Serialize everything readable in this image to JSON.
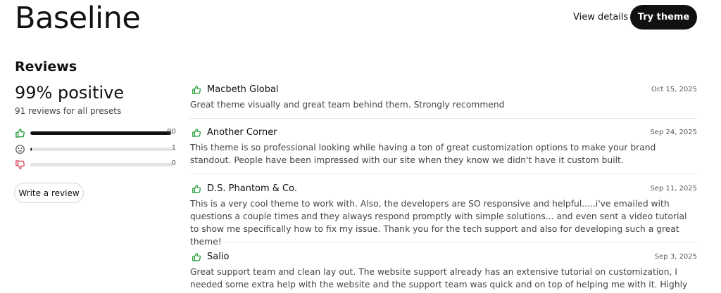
{
  "header": {
    "title": "Baseline",
    "view_details": "View details",
    "try_theme": "Try theme"
  },
  "summary": {
    "heading": "Reviews",
    "percent": "99% positive",
    "count": "91 reviews for all presets",
    "ratings": [
      {
        "name": "positive",
        "icon": "thumbs-up-icon",
        "count": "90",
        "fraction": 0.989
      },
      {
        "name": "neutral",
        "icon": "neutral-face-icon",
        "count": "1",
        "fraction": 0.011
      },
      {
        "name": "negative",
        "icon": "thumbs-down-icon",
        "count": "0",
        "fraction": 0.0
      }
    ],
    "write_review": "Write a review"
  },
  "reviews": [
    {
      "reviewer": "Macbeth Global",
      "date": "Oct 15, 2025",
      "text": "Great theme visually and great team behind them. Strongly recommend"
    },
    {
      "reviewer": "Another Corner",
      "date": "Sep 24, 2025",
      "text": "This theme is so professional looking while having a ton of great customization options to make your brand standout. People have been impressed with our site when they know we didn't have it custom built."
    },
    {
      "reviewer": "D.S. Phantom & Co.",
      "date": "Sep 11, 2025",
      "text": "This is a very cool theme to work with. Also, the developers are SO responsive and helpful.....i've emailed with questions a couple times and they always respond promptly with simple solutions... and even sent a video tutorial to show me specifically how to fix my issue. Thank you for the tech support and also for developing such a great theme!"
    },
    {
      "reviewer": "Salio",
      "date": "Sep 3, 2025",
      "text": "Great support team and clean lay out. The website support already has an extensive tutorial on customization, I needed some extra help with the website and the support team was quick and on top of helping me with it. Highly recommended!"
    }
  ],
  "colors": {
    "accent": "#111111",
    "positive_green": "#2e9e3f",
    "negative_red": "#e05561",
    "track_gray": "#e4e4e4"
  }
}
